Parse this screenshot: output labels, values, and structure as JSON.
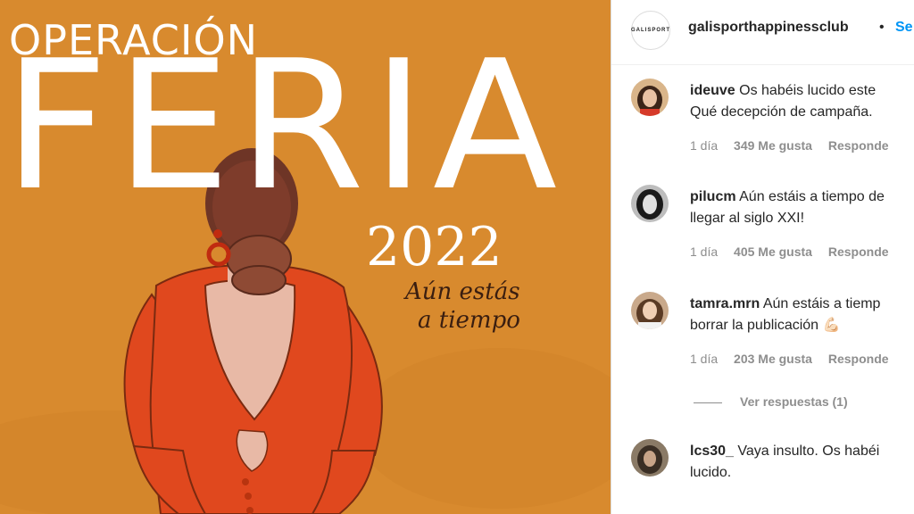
{
  "poster": {
    "line1": "OPERACIÓN",
    "line2": "FERIA",
    "year": "2022",
    "tagline_1": "Aún estás",
    "tagline_2": "a tiempo",
    "bg_color": "#d88a2e",
    "dress_color": "#e0481e"
  },
  "header": {
    "logo_text": "GALISPORT",
    "account": "galisporthappinessclub",
    "separator": "•",
    "follow_label": "Se"
  },
  "comments": [
    {
      "user": "ideuve",
      "line1": "Os habéis lucido este",
      "line2": "Qué decepción de campaña.",
      "time": "1 día",
      "likes": "349 Me gusta",
      "reply": "Responde"
    },
    {
      "user": "pilucm",
      "line1": "Aún estáis a tiempo de",
      "line2": "llegar al siglo XXI!",
      "time": "1 día",
      "likes": "405 Me gusta",
      "reply": "Responde"
    },
    {
      "user": "tamra.mrn",
      "line1": "Aún estáis a tiemp",
      "line2": "borrar la publicación 💪🏻",
      "time": "1 día",
      "likes": "203 Me gusta",
      "reply": "Responde"
    },
    {
      "user": "lcs30_",
      "line1": "Vaya insulto. Os habéi",
      "line2": "lucido."
    }
  ],
  "view_replies": "Ver respuestas (1)"
}
